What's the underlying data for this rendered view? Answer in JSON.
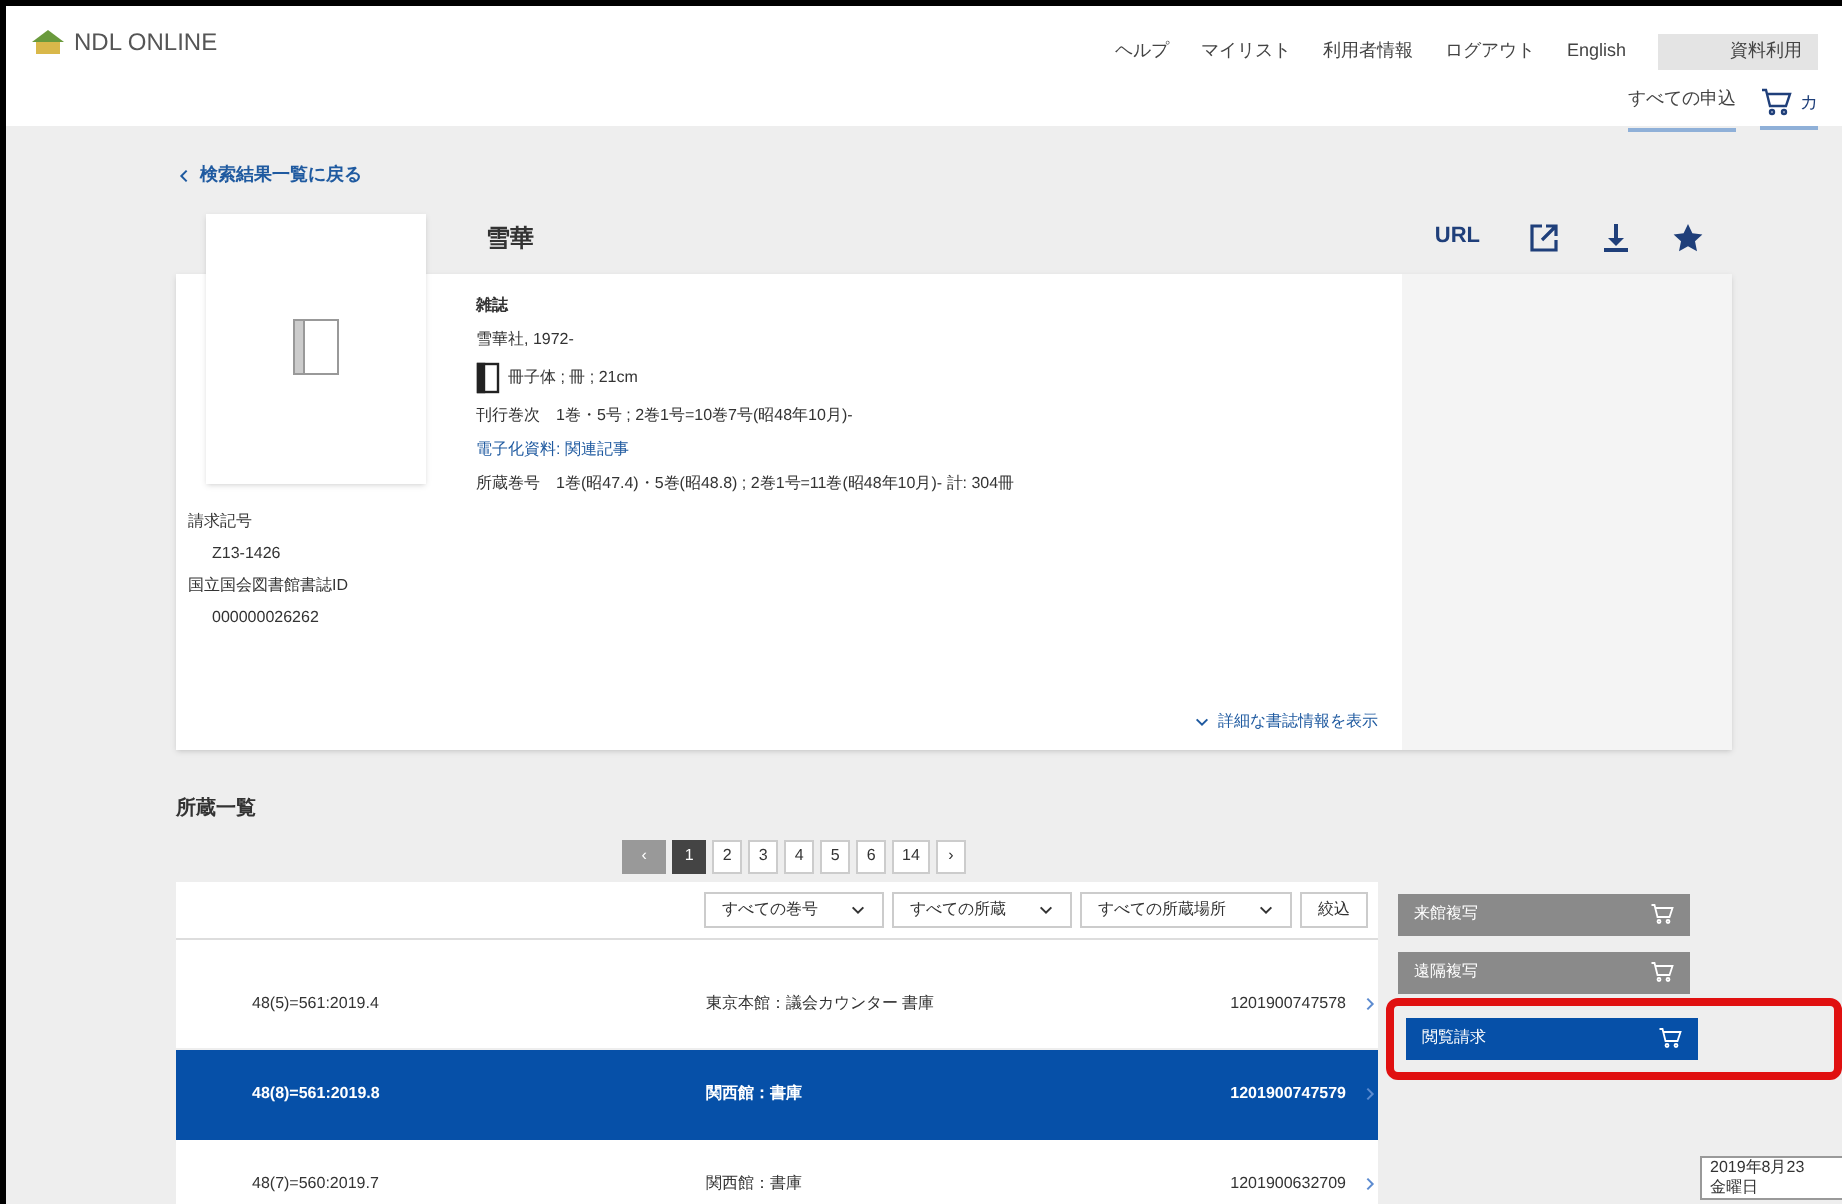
{
  "header": {
    "logo": "NDL ONLINE",
    "nav": [
      "ヘルプ",
      "マイリスト",
      "利用者情報",
      "ログアウト",
      "English"
    ],
    "status_box": "資料利用",
    "apply_link": "すべての申込",
    "cart_label": "カ"
  },
  "back_link": "検索結果一覧に戻る",
  "record": {
    "title": "雪華",
    "actions": [
      {
        "kind": "text",
        "label": "URL"
      },
      {
        "kind": "share"
      },
      {
        "kind": "download"
      },
      {
        "kind": "star"
      }
    ],
    "type": "雑誌",
    "publisher": "雪華社, 1972-",
    "format": "冊子体 ; 冊 ; 21cm",
    "fields": [
      {
        "label": "刊行巻次",
        "value": "1巻・5号 ; 2巻1号=10巻7号(昭48年10月)-",
        "kind": "plain"
      },
      {
        "label": "電子化資料: 関連記事",
        "kind": "link"
      },
      {
        "label": "所蔵巻号",
        "value": "1巻(昭47.4)・5巻(昭48.8) ; 2巻1号=11巻(昭48年10月)- 計: 304冊",
        "kind": "plain"
      }
    ],
    "call_number_label": "請求記号",
    "call_number": "Z13-1426",
    "biblio_id_label": "国立国会図書館書誌ID",
    "biblio_id": "000000026262",
    "detail_link": "詳細な書誌情報を表示"
  },
  "holdings": {
    "heading": "所蔵一覧",
    "pages": [
      {
        "label": "‹",
        "kind": "arrow",
        "selected": false
      },
      {
        "label": "1",
        "kind": "page",
        "selected": true
      },
      {
        "label": "2",
        "kind": "page",
        "selected": false
      },
      {
        "label": "3",
        "kind": "page",
        "selected": false
      },
      {
        "label": "4",
        "kind": "page",
        "selected": false
      },
      {
        "label": "5",
        "kind": "page",
        "selected": false
      },
      {
        "label": "6",
        "kind": "page",
        "selected": false
      },
      {
        "label": "14",
        "kind": "page",
        "selected": false
      },
      {
        "label": "›",
        "kind": "arrow",
        "selected": false
      }
    ],
    "filters": [
      "すべての巻号",
      "すべての所蔵",
      "すべての所蔵場所"
    ],
    "filter_button": "絞込",
    "rows": [
      {
        "volume": "48(5)=561:2019.4",
        "location": "東京本館：議会カウンター 書庫",
        "barcode": "1201900747578",
        "selected": false
      },
      {
        "volume": "48(8)=561:2019.8",
        "location": "関西館：書庫",
        "barcode": "1201900747579",
        "selected": true
      },
      {
        "volume": "48(7)=560:2019.7",
        "location": "関西館：書庫",
        "barcode": "1201900632709",
        "selected": false
      }
    ]
  },
  "request_buttons": [
    {
      "label": "来館複写",
      "enabled": false,
      "highlighted": false
    },
    {
      "label": "遠隔複写",
      "enabled": false,
      "highlighted": false
    },
    {
      "label": "閲覧請求",
      "enabled": true,
      "highlighted": true
    }
  ],
  "tooltip": [
    "2019年8月23",
    "金曜日"
  ]
}
